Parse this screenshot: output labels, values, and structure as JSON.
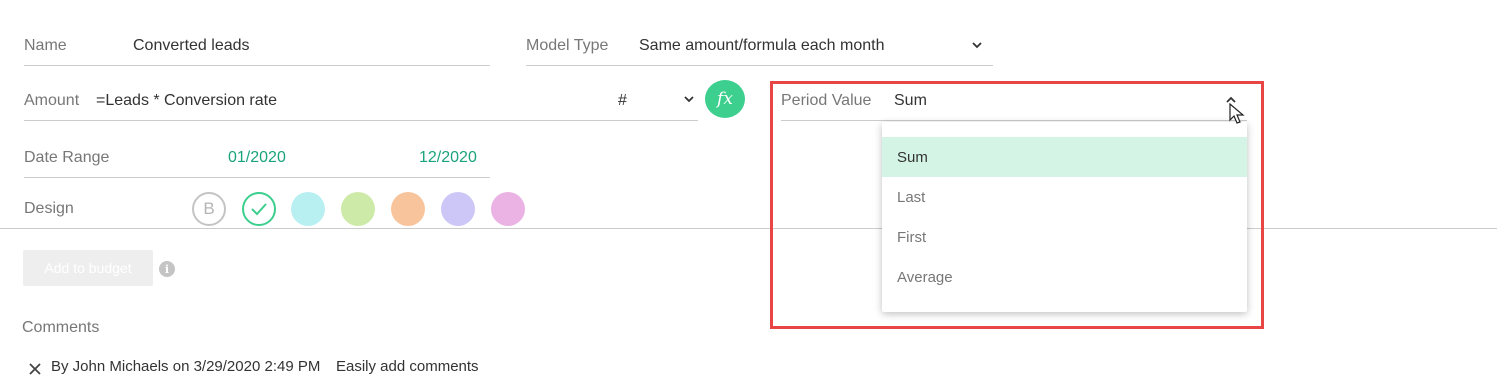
{
  "form": {
    "name_label": "Name",
    "name_value": "Converted leads",
    "model_type_label": "Model Type",
    "model_type_value": "Same amount/formula each month",
    "amount_label": "Amount",
    "amount_value": "=Leads * Conversion rate",
    "unit_value": "#",
    "fx_label": "fx",
    "date_range_label": "Date Range",
    "date_start": "01/2020",
    "date_end": "12/2020",
    "design_label": "Design",
    "design_b_label": "B",
    "design_colors": [
      "#b8f0f2",
      "#cdeaa8",
      "#f8c49c",
      "#cdc7f7",
      "#eab3e4"
    ],
    "add_button_label": "Add to budget",
    "info_icon": "i"
  },
  "period_value": {
    "label": "Period Value",
    "value": "Sum",
    "options": [
      "Sum",
      "Last",
      "First",
      "Average"
    ],
    "selected_index": 0
  },
  "comments": {
    "label": "Comments",
    "items": [
      {
        "author_line": "By John Michaels on 3/29/2020 2:49 PM",
        "text": "Easily add comments"
      }
    ]
  },
  "colors": {
    "accent": "#3ccf8e",
    "teal_text": "#1aa37d",
    "highlight": "#e84545",
    "selected_bg": "#d4f5e6"
  }
}
